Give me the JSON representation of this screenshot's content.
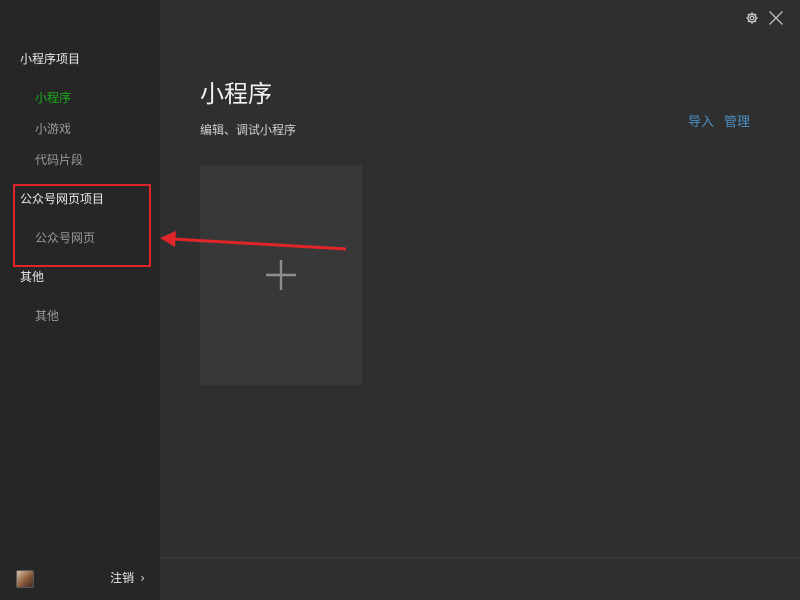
{
  "sidebar": {
    "sections": [
      {
        "title": "小程序项目",
        "items": [
          "小程序",
          "小游戏",
          "代码片段"
        ]
      },
      {
        "title": "公众号网页项目",
        "items": [
          "公众号网页"
        ]
      },
      {
        "title": "其他",
        "items": [
          "其他"
        ]
      }
    ],
    "active_item": "小程序",
    "footer": {
      "logout_label": "注销",
      "chevron": "›"
    }
  },
  "main": {
    "title": "小程序",
    "subtitle": "编辑、调试小程序",
    "actions": {
      "import_label": "导入",
      "manage_label": "管理"
    },
    "add_card": {
      "icon": "plus-icon"
    }
  },
  "window_controls": {
    "settings_icon": "gear-icon",
    "close_icon": "close-icon"
  },
  "annotation": {
    "highlight_target": "公众号网页项目",
    "color": "#e0262a"
  },
  "colors": {
    "active": "#1aad19",
    "link": "#4a8fc3",
    "sidebar_bg": "#262626",
    "main_bg": "#2f2f2f",
    "card_bg": "#383838"
  }
}
